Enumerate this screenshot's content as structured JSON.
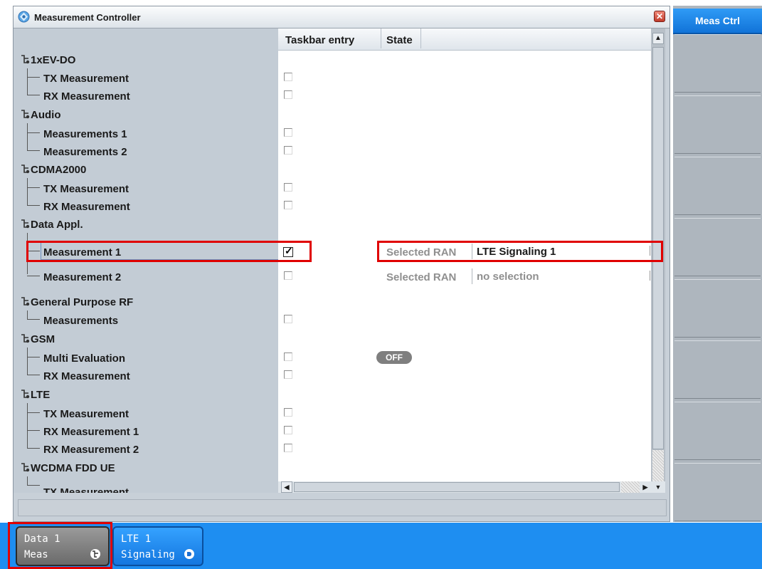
{
  "window": {
    "title": "Measurement Controller",
    "close_glyph": "✕"
  },
  "columns": {
    "taskbar_entry": "Taskbar entry",
    "state": "State"
  },
  "groups": [
    {
      "label": "1xEV-DO",
      "children": [
        {
          "label": "TX Measurement",
          "checked": false
        },
        {
          "label": "RX Measurement",
          "checked": false
        }
      ]
    },
    {
      "label": "Audio",
      "children": [
        {
          "label": "Measurements 1",
          "checked": false
        },
        {
          "label": "Measurements 2",
          "checked": false
        }
      ]
    },
    {
      "label": "CDMA2000",
      "children": [
        {
          "label": "TX Measurement",
          "checked": false
        },
        {
          "label": "RX Measurement",
          "checked": false
        }
      ]
    },
    {
      "label": "Data Appl.",
      "children": [
        {
          "label": "Measurement 1",
          "checked": true,
          "ran_label": "Selected RAN",
          "ran_value": "LTE Signaling 1"
        },
        {
          "label": "Measurement 2",
          "checked": false,
          "ran_label": "Selected RAN",
          "ran_value": "no selection"
        }
      ]
    },
    {
      "label": "General Purpose RF",
      "children": [
        {
          "label": "Measurements",
          "checked": false
        }
      ]
    },
    {
      "label": "GSM",
      "children": [
        {
          "label": "Multi Evaluation",
          "checked": false,
          "state": "OFF"
        },
        {
          "label": "RX Measurement",
          "checked": false
        }
      ]
    },
    {
      "label": "LTE",
      "children": [
        {
          "label": "TX Measurement",
          "checked": false
        },
        {
          "label": "RX Measurement 1",
          "checked": false
        },
        {
          "label": "RX Measurement 2",
          "checked": false
        }
      ]
    },
    {
      "label": "WCDMA FDD UE",
      "children": [
        {
          "label": "TX Measurement",
          "checked": false
        }
      ]
    }
  ],
  "softkeys": {
    "active_label": "Meas Ctrl"
  },
  "taskbar": {
    "tasks": [
      {
        "line1": "Data 1",
        "line2": "Meas",
        "icon": "meas-icon"
      },
      {
        "line1": "LTE 1",
        "line2": "Signaling",
        "icon": "signaling-icon"
      }
    ]
  },
  "colors": {
    "accent": "#1e8ef1",
    "highlight": "#e00000",
    "tree_bg": "#c3ccd5"
  }
}
